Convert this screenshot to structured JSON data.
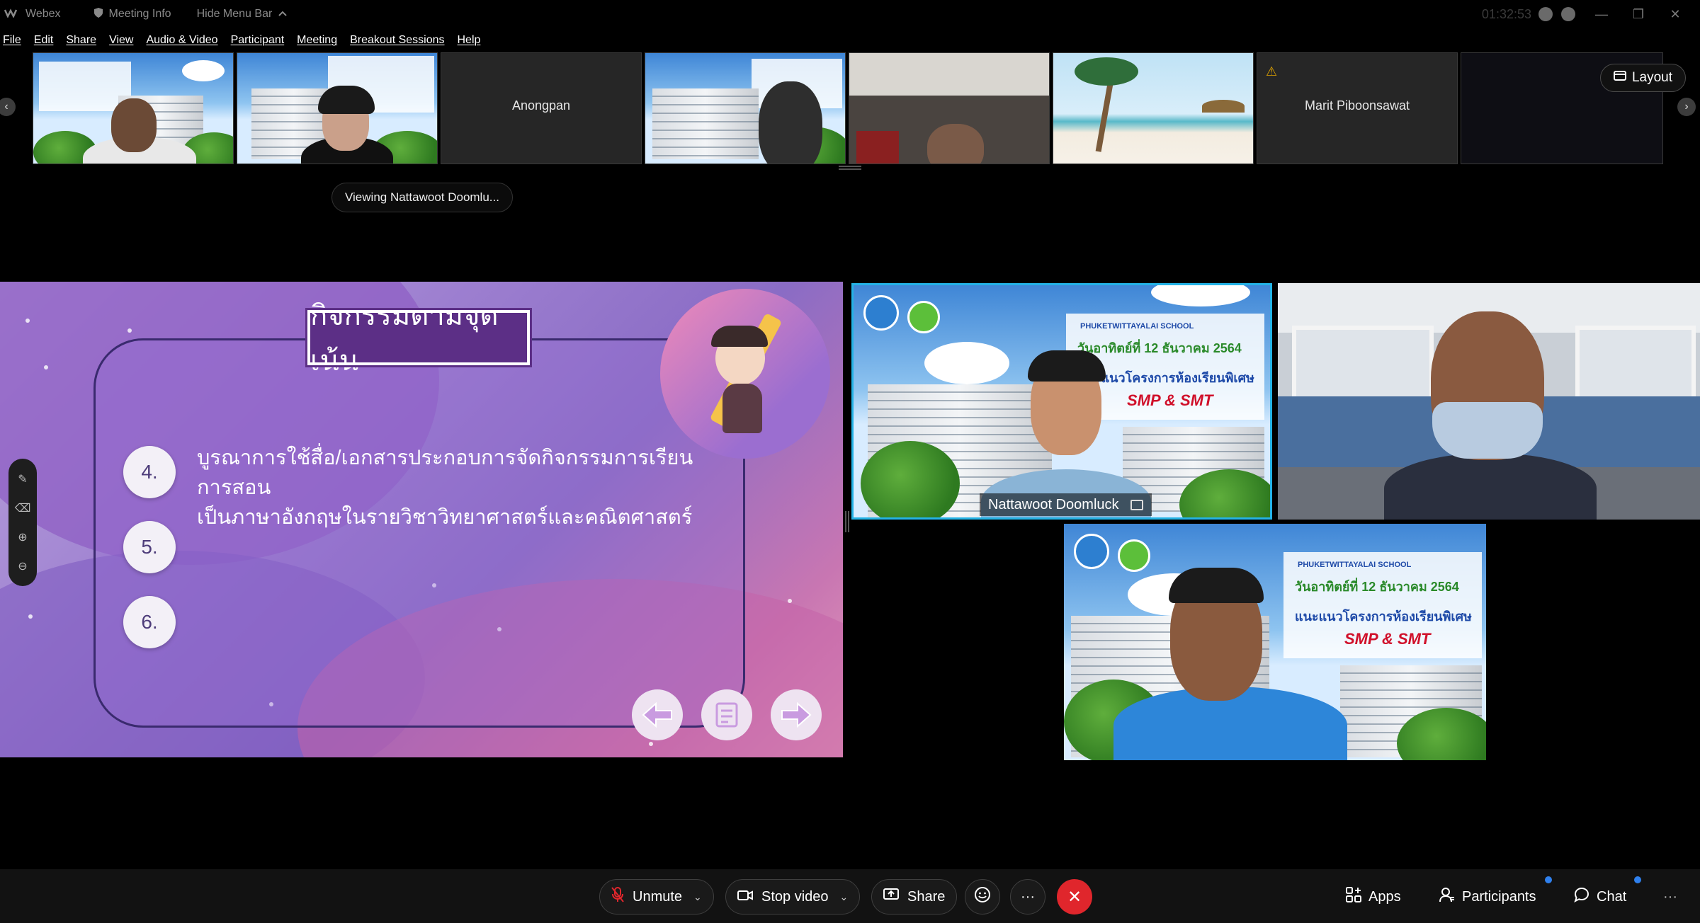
{
  "titlebar": {
    "app_name": "Webex",
    "meeting_info": "Meeting Info",
    "hide_menu": "Hide Menu Bar",
    "clock": "01:32:53"
  },
  "menu": [
    "File",
    "Edit",
    "Share",
    "View",
    "Audio & Video",
    "Participant",
    "Meeting",
    "Breakout Sessions",
    "Help"
  ],
  "filmstrip": {
    "names": {
      "anongpan": "Anongpan",
      "marit": "Marit Piboonsawat"
    },
    "layout_label": "Layout"
  },
  "viewing_label": "Viewing Nattawoot Doomlu...",
  "slide": {
    "title": "กิจกรรมตามจุดเน้น",
    "items": [
      {
        "num": "4.",
        "text_line1": "บูรณาการใช้สื่อ/เอกสารประกอบการจัดกิจกรรมการเรียนการสอน",
        "text_line2": "เป็นภาษาอังกฤษในรายวิชาวิทยาศาสตร์และคณิตศาสตร์"
      },
      {
        "num": "5."
      },
      {
        "num": "6."
      }
    ]
  },
  "backdrop": {
    "school": "PHUKETWITTAYALAI SCHOOL",
    "date": "วันอาทิตย์ที่ 12 ธันวาคม 2564",
    "project": "แนะแนวโครงการห้องเรียนพิเศษ",
    "program": "SMP & SMT"
  },
  "tiles": {
    "active_name": "Nattawoot Doomluck"
  },
  "controls": {
    "unmute": "Unmute",
    "stop_video": "Stop video",
    "share": "Share",
    "more": "···",
    "apps": "Apps",
    "participants": "Participants",
    "chat": "Chat",
    "overflow": "···"
  },
  "colors": {
    "accent_active_border": "#24b3e6",
    "leave_red": "#e0262c",
    "notification_dot": "#2f80ed",
    "slide_title_bg": "#5c2f86"
  },
  "icons": {
    "mic": "mic-muted-icon",
    "camera": "camera-icon",
    "share": "share-screen-icon",
    "reactions": "reactions-icon",
    "leave": "close-icon",
    "apps": "apps-grid-icon",
    "participants": "person-icon",
    "chat": "chat-bubble-icon"
  }
}
